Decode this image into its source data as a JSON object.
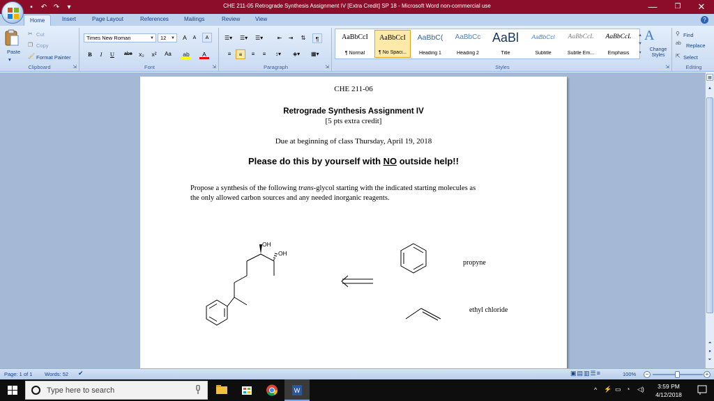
{
  "window": {
    "title": "CHE 211-05 Retrograde Synthesis Assignment IV [Extra Credit] SP 18  -  Microsoft Word non-commercial use",
    "minimize": "—",
    "restore": "❐",
    "close": "✕"
  },
  "quick_access": [
    "save-icon",
    "undo-icon",
    "redo-icon",
    "customize-icon"
  ],
  "tabs": [
    "Home",
    "Insert",
    "Page Layout",
    "References",
    "Mailings",
    "Review",
    "View"
  ],
  "active_tab": "Home",
  "ribbon": {
    "clipboard": {
      "paste": "Paste",
      "cut": "Cut",
      "copy": "Copy",
      "format_painter": "Format Painter",
      "label": "Clipboard"
    },
    "font": {
      "font_name": "Times New Roman",
      "font_size": "12",
      "bold": "B",
      "italic": "I",
      "underline": "U",
      "strike": "abe",
      "subscript": "x₂",
      "superscript": "x²",
      "change_case": "Aa",
      "grow": "A",
      "shrink": "A",
      "clear": "A",
      "label": "Font"
    },
    "paragraph": {
      "label": "Paragraph",
      "pilcrow": "¶"
    },
    "styles": {
      "label": "Styles",
      "items": [
        {
          "sample": "AaBbCcI",
          "name": "¶ Normal"
        },
        {
          "sample": "AaBbCcI",
          "name": "¶ No Spaci..."
        },
        {
          "sample": "AaBbC(",
          "name": "Heading 1"
        },
        {
          "sample": "AaBbCc",
          "name": "Heading 2"
        },
        {
          "sample": "AaBl",
          "name": "Title"
        },
        {
          "sample": "AaBbCcl",
          "name": "Subtitle"
        },
        {
          "sample": "AaBbCcL",
          "name": "Subtle Em..."
        },
        {
          "sample": "AaBbCcL",
          "name": "Emphasis"
        }
      ],
      "selected_index": 1,
      "change_styles": "Change Styles"
    },
    "editing": {
      "find": "Find",
      "replace": "Replace",
      "select": "Select",
      "label": "Editing"
    }
  },
  "document": {
    "course": "CHE 211-06",
    "assignment_title": "Retrograde Synthesis Assignment IV",
    "credit_note": "[5 pts extra credit]",
    "due": "Due at beginning of class Thursday, April 19, 2018",
    "warning_prefix": "Please do this by yourself with ",
    "warning_emph": "NO",
    "warning_suffix": " outside help!!",
    "prompt_a": "Propose a synthesis of the following ",
    "prompt_italic": "trans",
    "prompt_b": "-glycol starting with the indicated starting molecules as",
    "prompt_line2": "the only allowed carbon sources and any needed inorganic reagents.",
    "target_labels": [
      "OH",
      "OH"
    ],
    "reagent_labels": [
      "propyne",
      "ethyl chloride"
    ]
  },
  "status": {
    "page": "Page: 1 of 1",
    "words": "Words: 52",
    "zoom": "100%"
  },
  "taskbar": {
    "search_placeholder": "Type here to search",
    "time": "3:59 PM",
    "date": "4/12/2018"
  },
  "colors": {
    "titlebar": "#8b0d2a",
    "ribbon": "#c9dbf2",
    "docbg": "#a5b9d7",
    "taskbar": "#0e0e0e"
  }
}
